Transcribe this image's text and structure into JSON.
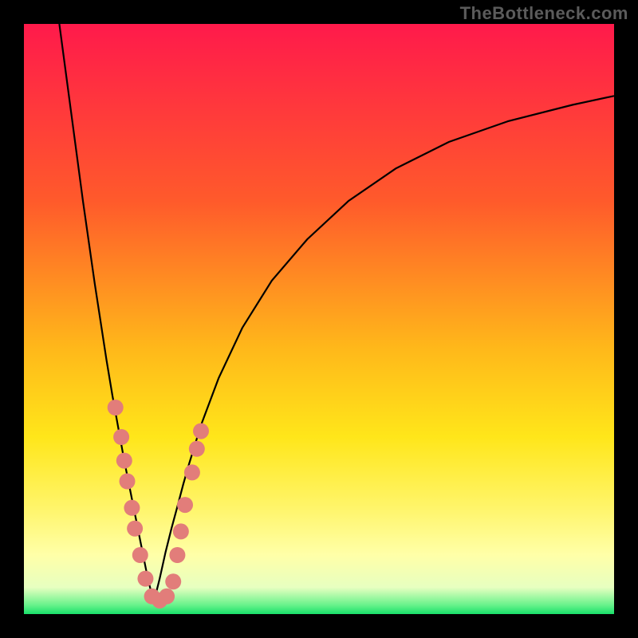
{
  "watermark": "TheBottleneck.com",
  "chart_data": {
    "type": "line",
    "title": "",
    "xlabel": "",
    "ylabel": "",
    "xlim": [
      0,
      100
    ],
    "ylim": [
      0,
      100
    ],
    "vertex_x": 22,
    "background_gradient": {
      "stops": [
        {
          "pos": 0.0,
          "color": "#ff1a4b"
        },
        {
          "pos": 0.3,
          "color": "#ff5a2b"
        },
        {
          "pos": 0.55,
          "color": "#ffb81a"
        },
        {
          "pos": 0.7,
          "color": "#ffe61a"
        },
        {
          "pos": 0.82,
          "color": "#fff56a"
        },
        {
          "pos": 0.9,
          "color": "#ffffa8"
        },
        {
          "pos": 0.955,
          "color": "#e7ffc0"
        },
        {
          "pos": 0.985,
          "color": "#66f28a"
        },
        {
          "pos": 1.0,
          "color": "#18e06a"
        }
      ]
    },
    "series": [
      {
        "name": "left-branch",
        "x": [
          6,
          8,
          10,
          12,
          14,
          15,
          16,
          17,
          18,
          19,
          20,
          21,
          22
        ],
        "y": [
          100,
          85,
          70,
          56,
          43,
          37,
          31.5,
          26,
          21,
          16,
          11,
          6,
          2
        ]
      },
      {
        "name": "right-branch",
        "x": [
          22,
          23,
          24,
          25,
          26,
          27,
          28,
          30,
          33,
          37,
          42,
          48,
          55,
          63,
          72,
          82,
          93,
          100
        ],
        "y": [
          2,
          6,
          10.5,
          14.5,
          18.2,
          22,
          25.5,
          32,
          40,
          48.5,
          56.5,
          63.5,
          70,
          75.5,
          80,
          83.5,
          86.3,
          87.8
        ]
      }
    ],
    "markers": {
      "name": "data-dots",
      "color": "#e27d7a",
      "radius": 10,
      "points": [
        {
          "x": 15.5,
          "y": 35
        },
        {
          "x": 16.5,
          "y": 30
        },
        {
          "x": 17.0,
          "y": 26
        },
        {
          "x": 17.5,
          "y": 22.5
        },
        {
          "x": 18.3,
          "y": 18
        },
        {
          "x": 18.8,
          "y": 14.5
        },
        {
          "x": 19.7,
          "y": 10
        },
        {
          "x": 20.6,
          "y": 6
        },
        {
          "x": 21.7,
          "y": 3
        },
        {
          "x": 23.0,
          "y": 2.3
        },
        {
          "x": 24.2,
          "y": 3
        },
        {
          "x": 25.3,
          "y": 5.5
        },
        {
          "x": 26.0,
          "y": 10
        },
        {
          "x": 26.6,
          "y": 14
        },
        {
          "x": 27.3,
          "y": 18.5
        },
        {
          "x": 28.5,
          "y": 24
        },
        {
          "x": 29.3,
          "y": 28
        },
        {
          "x": 30.0,
          "y": 31
        }
      ]
    }
  }
}
